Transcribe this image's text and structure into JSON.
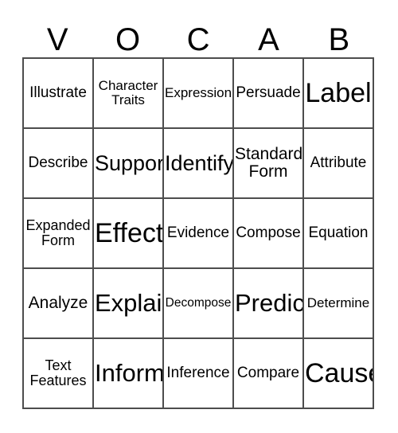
{
  "card": {
    "title_letters": [
      "V",
      "O",
      "C",
      "A",
      "B"
    ],
    "line_color": "#4d4d4d",
    "text_color": "#000000",
    "background": "#ffffff",
    "rows": 5,
    "columns": 5,
    "cells": [
      [
        {
          "text": "Illustrate",
          "size": "m"
        },
        {
          "text": "Character\nTraits",
          "size": "s"
        },
        {
          "text": "Expression",
          "size": "s"
        },
        {
          "text": "Persuade",
          "size": "m"
        },
        {
          "text": "Label",
          "size": "huge"
        }
      ],
      [
        {
          "text": "Describe",
          "size": "m"
        },
        {
          "text": "Support",
          "size": "xl"
        },
        {
          "text": "Identify",
          "size": "xl"
        },
        {
          "text": "Standard\nForm",
          "size": "ml"
        },
        {
          "text": "Attribute",
          "size": "m"
        }
      ],
      [
        {
          "text": "Expanded\nForm",
          "size": "sm"
        },
        {
          "text": "Effect",
          "size": "huge"
        },
        {
          "text": "Evidence",
          "size": "m"
        },
        {
          "text": "Compose",
          "size": "m"
        },
        {
          "text": "Equation",
          "size": "m"
        }
      ],
      [
        {
          "text": "Analyze",
          "size": "ml"
        },
        {
          "text": "Explain",
          "size": "xxl"
        },
        {
          "text": "Decompose",
          "size": "xs"
        },
        {
          "text": "Predict",
          "size": "xxl"
        },
        {
          "text": "Determine",
          "size": "s"
        }
      ],
      [
        {
          "text": "Text\nFeatures",
          "size": "sm"
        },
        {
          "text": "Inform",
          "size": "xxl"
        },
        {
          "text": "Inference",
          "size": "m"
        },
        {
          "text": "Compare",
          "size": "m"
        },
        {
          "text": "Cause",
          "size": "huge"
        }
      ]
    ]
  }
}
